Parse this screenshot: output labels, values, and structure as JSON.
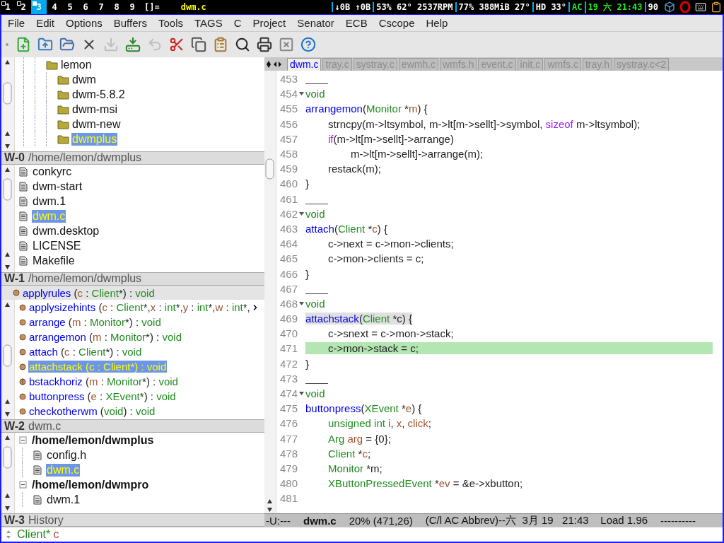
{
  "top_bar": {
    "workspaces": [
      {
        "label": "1",
        "selected": false,
        "occupied": true
      },
      {
        "label": "2",
        "selected": false,
        "occupied": true
      },
      {
        "label": "3",
        "selected": true,
        "occupied": true
      },
      {
        "label": "4",
        "selected": false,
        "occupied": false
      },
      {
        "label": "5",
        "selected": false,
        "occupied": false
      },
      {
        "label": "6",
        "selected": false,
        "occupied": false
      },
      {
        "label": "7",
        "selected": false,
        "occupied": false
      },
      {
        "label": "8",
        "selected": false,
        "occupied": false
      },
      {
        "label": "9",
        "selected": false,
        "occupied": false
      }
    ],
    "layout": "[]=",
    "title": "dwm.c",
    "status": [
      {
        "text": "↓0B ↑0B",
        "color": "#ffffff"
      },
      {
        "text": "53% 62° 2537RPM",
        "color": "#ffffff"
      },
      {
        "text": "77% 388MiB 27°",
        "color": "#ffffff"
      },
      {
        "text": "HD 33°",
        "color": "#ffffff"
      },
      {
        "text": "AC",
        "color": "#22ee22"
      },
      {
        "text": "19 六 21:43",
        "color": "#22ee22"
      },
      {
        "text": "90",
        "color": "#ffffff"
      }
    ],
    "tray": [
      {
        "kind": "dropbox"
      },
      {
        "kind": "ring"
      },
      {
        "kind": "keyboard"
      },
      {
        "kind": "clipboard"
      }
    ]
  },
  "menu": [
    "File",
    "Edit",
    "Options",
    "Buffers",
    "Tools",
    "TAGS",
    "C",
    "Project",
    "Senator",
    "ECB",
    "Cscope",
    "Help"
  ],
  "toolbar": [
    {
      "kind": "new",
      "disabled": false
    },
    {
      "kind": "open",
      "disabled": false
    },
    {
      "kind": "dired",
      "disabled": false
    },
    {
      "kind": "close",
      "disabled": false
    },
    {
      "kind": "save",
      "disabled": true
    },
    {
      "kind": "saveas",
      "disabled": false
    },
    {
      "kind": "undo",
      "disabled": true
    },
    {
      "kind": "cut",
      "disabled": false
    },
    {
      "kind": "copy",
      "disabled": false
    },
    {
      "kind": "paste",
      "disabled": false
    },
    {
      "kind": "search",
      "disabled": false
    },
    {
      "kind": "print",
      "disabled": false
    },
    {
      "kind": "customize",
      "disabled": false
    },
    {
      "kind": "help",
      "disabled": false
    }
  ],
  "directories": {
    "header": {
      "key": "W-0",
      "title": "/home/lemon/dwmplus"
    },
    "tree": [
      {
        "label": "lemon",
        "selected": false,
        "children": [
          {
            "label": "dwm",
            "selected": false
          },
          {
            "label": "dwm-5.8.2",
            "selected": false
          },
          {
            "label": "dwm-msi",
            "selected": false
          },
          {
            "label": "dwm-new",
            "selected": false
          },
          {
            "label": "dwmplus",
            "selected": true
          }
        ]
      }
    ]
  },
  "sources": {
    "header": {
      "key": "W-1",
      "title": "/home/lemon/dwmplus"
    },
    "items": [
      {
        "label": "conkyrc",
        "selected": false
      },
      {
        "label": "dwm-start",
        "selected": false
      },
      {
        "label": "dwm.1",
        "selected": false
      },
      {
        "label": "dwm.c",
        "selected": true
      },
      {
        "label": "dwm.desktop",
        "selected": false
      },
      {
        "label": "LICENSE",
        "selected": false
      },
      {
        "label": "Makefile",
        "selected": false
      }
    ]
  },
  "methods": {
    "header": {
      "key": "W-2",
      "title": "dwm.c"
    },
    "items": [
      {
        "kind": "sticky",
        "selected": false,
        "tokens": [
          {
            "text": "applyrules",
            "kind": "fn"
          },
          {
            "text": " (",
            "kind": "p"
          },
          {
            "text": "c",
            "kind": "var"
          },
          {
            "text": " : ",
            "kind": "p"
          },
          {
            "text": "Client",
            "kind": "type"
          },
          {
            "text": "*) : ",
            "kind": "p"
          },
          {
            "text": "void",
            "kind": "type"
          }
        ]
      },
      {
        "kind": "public",
        "selected": false,
        "truncated": true,
        "tokens": [
          {
            "text": "applysizehints",
            "kind": "fn"
          },
          {
            "text": " (",
            "kind": "p"
          },
          {
            "text": "c",
            "kind": "var"
          },
          {
            "text": " : ",
            "kind": "p"
          },
          {
            "text": "Client",
            "kind": "type"
          },
          {
            "text": "*,",
            "kind": "p"
          },
          {
            "text": "x",
            "kind": "var"
          },
          {
            "text": " : ",
            "kind": "p"
          },
          {
            "text": "int",
            "kind": "type"
          },
          {
            "text": "*,",
            "kind": "p"
          },
          {
            "text": "y",
            "kind": "var"
          },
          {
            "text": " : ",
            "kind": "p"
          },
          {
            "text": "int",
            "kind": "type"
          },
          {
            "text": "*,",
            "kind": "p"
          },
          {
            "text": "w",
            "kind": "var"
          },
          {
            "text": " : ",
            "kind": "p"
          },
          {
            "text": "int",
            "kind": "type"
          },
          {
            "text": "*,",
            "kind": "p"
          }
        ]
      },
      {
        "kind": "public",
        "selected": false,
        "tokens": [
          {
            "text": "arrange",
            "kind": "fn"
          },
          {
            "text": " (",
            "kind": "p"
          },
          {
            "text": "m",
            "kind": "var"
          },
          {
            "text": " : ",
            "kind": "p"
          },
          {
            "text": "Monitor",
            "kind": "type"
          },
          {
            "text": "*) : ",
            "kind": "p"
          },
          {
            "text": "void",
            "kind": "type"
          }
        ]
      },
      {
        "kind": "public",
        "selected": false,
        "tokens": [
          {
            "text": "arrangemon",
            "kind": "fn"
          },
          {
            "text": " (",
            "kind": "p"
          },
          {
            "text": "m",
            "kind": "var"
          },
          {
            "text": " : ",
            "kind": "p"
          },
          {
            "text": "Monitor",
            "kind": "type"
          },
          {
            "text": "*) : ",
            "kind": "p"
          },
          {
            "text": "void",
            "kind": "type"
          }
        ]
      },
      {
        "kind": "public",
        "selected": false,
        "tokens": [
          {
            "text": "attach",
            "kind": "fn"
          },
          {
            "text": " (",
            "kind": "p"
          },
          {
            "text": "c",
            "kind": "var"
          },
          {
            "text": " : ",
            "kind": "p"
          },
          {
            "text": "Client",
            "kind": "type"
          },
          {
            "text": "*) : ",
            "kind": "p"
          },
          {
            "text": "void",
            "kind": "type"
          }
        ]
      },
      {
        "kind": "public",
        "selected": true,
        "tokens": [
          {
            "text": "attachstack",
            "kind": "fn"
          },
          {
            "text": " (",
            "kind": "p"
          },
          {
            "text": "c",
            "kind": "var"
          },
          {
            "text": " : ",
            "kind": "p"
          },
          {
            "text": "Client",
            "kind": "type"
          },
          {
            "text": "*) : ",
            "kind": "p"
          },
          {
            "text": "void",
            "kind": "type"
          }
        ]
      },
      {
        "kind": "static",
        "selected": false,
        "tokens": [
          {
            "text": "bstackhoriz",
            "kind": "fn"
          },
          {
            "text": " (",
            "kind": "p"
          },
          {
            "text": "m",
            "kind": "var"
          },
          {
            "text": " : ",
            "kind": "p"
          },
          {
            "text": "Monitor",
            "kind": "type"
          },
          {
            "text": "*) : ",
            "kind": "p"
          },
          {
            "text": "void",
            "kind": "type"
          }
        ]
      },
      {
        "kind": "public",
        "selected": false,
        "tokens": [
          {
            "text": "buttonpress",
            "kind": "fn"
          },
          {
            "text": " (",
            "kind": "p"
          },
          {
            "text": "e",
            "kind": "var"
          },
          {
            "text": " : ",
            "kind": "p"
          },
          {
            "text": "XEvent",
            "kind": "type"
          },
          {
            "text": "*) : ",
            "kind": "p"
          },
          {
            "text": "void",
            "kind": "type"
          }
        ]
      },
      {
        "kind": "public",
        "selected": false,
        "tokens": [
          {
            "text": "checkotherwm",
            "kind": "fn"
          },
          {
            "text": " (",
            "kind": "p"
          },
          {
            "text": "void",
            "kind": "type"
          },
          {
            "text": ") : ",
            "kind": "p"
          },
          {
            "text": "void",
            "kind": "type"
          }
        ]
      }
    ]
  },
  "history": {
    "header": {
      "key": "W-3",
      "title": "History"
    },
    "tree": [
      {
        "label": "/home/lemon/dwmplus",
        "selected": false,
        "expanded": true,
        "children": [
          {
            "label": "config.h",
            "selected": false
          },
          {
            "label": "dwm.c",
            "selected": true
          }
        ]
      },
      {
        "label": "/home/lemon/dwmpro",
        "selected": false,
        "expanded": true,
        "children": [
          {
            "label": "dwm.1",
            "selected": false
          }
        ]
      }
    ]
  },
  "tabs": [
    {
      "label": "dwm.c",
      "selected": true
    },
    {
      "label": "tray.c",
      "selected": false
    },
    {
      "label": "systray.c",
      "selected": false
    },
    {
      "label": "ewmh.c",
      "selected": false
    },
    {
      "label": "wmfs.h",
      "selected": false
    },
    {
      "label": "event.c",
      "selected": false
    },
    {
      "label": "init.c",
      "selected": false
    },
    {
      "label": "wmfs.c",
      "selected": false
    },
    {
      "label": "tray.h",
      "selected": false
    },
    {
      "label": "systray.c<2",
      "selected": false
    }
  ],
  "code": [
    {
      "num": "453",
      "separator": true
    },
    {
      "num": "454",
      "fold": true,
      "tokens": [
        {
          "text": "void",
          "kind": "type"
        }
      ]
    },
    {
      "num": "455",
      "tokens": [
        {
          "text": "arrangemon",
          "kind": "fn"
        },
        {
          "text": "(",
          "kind": "p"
        },
        {
          "text": "Monitor",
          "kind": "type"
        },
        {
          "text": " *",
          "kind": "p"
        },
        {
          "text": "m",
          "kind": "var"
        },
        {
          "text": ") {",
          "kind": "p"
        }
      ]
    },
    {
      "num": "456",
      "kind": "body",
      "tokens": [
        {
          "text": "strncpy(m->ltsymbol, m->lt[m->sellt]->symbol, ",
          "kind": "p"
        },
        {
          "text": "sizeof",
          "kind": "kw"
        },
        {
          "text": " m->ltsymbol);",
          "kind": "p"
        }
      ]
    },
    {
      "num": "457",
      "kind": "body",
      "tokens": [
        {
          "text": "if",
          "kind": "kw"
        },
        {
          "text": "(m->lt[m->sellt]->arrange)",
          "kind": "p"
        }
      ]
    },
    {
      "num": "458",
      "kind": "nested",
      "tokens": [
        {
          "text": "m->lt[m->sellt]->arrange(m);",
          "kind": "p"
        }
      ]
    },
    {
      "num": "459",
      "kind": "body",
      "tokens": [
        {
          "text": "restack(m);",
          "kind": "p"
        }
      ]
    },
    {
      "num": "460",
      "tokens": [
        {
          "text": "}",
          "kind": "p"
        }
      ]
    },
    {
      "num": "461",
      "separator": true
    },
    {
      "num": "462",
      "fold": true,
      "tokens": [
        {
          "text": "void",
          "kind": "type"
        }
      ]
    },
    {
      "num": "463",
      "tokens": [
        {
          "text": "attach",
          "kind": "fn"
        },
        {
          "text": "(",
          "kind": "p"
        },
        {
          "text": "Client",
          "kind": "type"
        },
        {
          "text": " *",
          "kind": "p"
        },
        {
          "text": "c",
          "kind": "var"
        },
        {
          "text": ") {",
          "kind": "p"
        }
      ]
    },
    {
      "num": "464",
      "kind": "body",
      "tokens": [
        {
          "text": "c->next = c->mon->clients;",
          "kind": "p"
        }
      ]
    },
    {
      "num": "465",
      "kind": "body",
      "tokens": [
        {
          "text": "c->mon->clients = c;",
          "kind": "p"
        }
      ]
    },
    {
      "num": "466",
      "tokens": [
        {
          "text": "}",
          "kind": "p"
        }
      ]
    },
    {
      "num": "467",
      "separator": true
    },
    {
      "num": "468",
      "fold": true,
      "tokens": [
        {
          "text": "void",
          "kind": "type"
        }
      ]
    },
    {
      "num": "469",
      "current_tag": true,
      "tokens": [
        {
          "text": "attachstack",
          "kind": "fn"
        },
        {
          "text": "(",
          "kind": "p"
        },
        {
          "text": "Client",
          "kind": "type"
        },
        {
          "text": " *c) {",
          "kind": "p"
        }
      ]
    },
    {
      "num": "470",
      "kind": "body",
      "tokens": [
        {
          "text": "c->snext = c->mon->stack;",
          "kind": "p"
        }
      ]
    },
    {
      "num": "471",
      "kind": "body",
      "current_line": true,
      "tokens": [
        {
          "text": "c->mon->stack = c;",
          "kind": "p"
        }
      ]
    },
    {
      "num": "472",
      "tokens": [
        {
          "text": "}",
          "kind": "p"
        }
      ]
    },
    {
      "num": "473",
      "separator": true
    },
    {
      "num": "474",
      "fold": true,
      "tokens": [
        {
          "text": "void",
          "kind": "type"
        }
      ]
    },
    {
      "num": "475",
      "tokens": [
        {
          "text": "buttonpress",
          "kind": "fn"
        },
        {
          "text": "(",
          "kind": "p"
        },
        {
          "text": "XEvent",
          "kind": "type"
        },
        {
          "text": " *",
          "kind": "p"
        },
        {
          "text": "e",
          "kind": "var"
        },
        {
          "text": ") {",
          "kind": "p"
        }
      ]
    },
    {
      "num": "476",
      "kind": "body",
      "tokens": [
        {
          "text": "unsigned int",
          "kind": "type"
        },
        {
          "text": " i",
          "kind": "var"
        },
        {
          "text": ", ",
          "kind": "p"
        },
        {
          "text": "x",
          "kind": "var"
        },
        {
          "text": ", ",
          "kind": "p"
        },
        {
          "text": "click",
          "kind": "var"
        },
        {
          "text": ";",
          "kind": "p"
        }
      ]
    },
    {
      "num": "477",
      "kind": "body",
      "tokens": [
        {
          "text": "Arg",
          "kind": "type"
        },
        {
          "text": " arg",
          "kind": "var"
        },
        {
          "text": " = {0};",
          "kind": "p"
        }
      ]
    },
    {
      "num": "478",
      "kind": "body",
      "tokens": [
        {
          "text": "Client",
          "kind": "type"
        },
        {
          "text": " *",
          "kind": "p"
        },
        {
          "text": "c",
          "kind": "var"
        },
        {
          "text": ";",
          "kind": "p"
        }
      ]
    },
    {
      "num": "479",
      "kind": "body",
      "tokens": [
        {
          "text": "Monitor",
          "kind": "type"
        },
        {
          "text": " *m;",
          "kind": "p"
        }
      ]
    },
    {
      "num": "480",
      "kind": "body",
      "tokens": [
        {
          "text": "XButtonPressedEvent",
          "kind": "type"
        },
        {
          "text": " *",
          "kind": "p"
        },
        {
          "text": "ev",
          "kind": "var"
        },
        {
          "text": " = &e->xbutton;",
          "kind": "p"
        }
      ]
    },
    {
      "num": "481"
    }
  ],
  "mode_line": [
    {
      "text": "-U:---",
      "bold": false
    },
    {
      "text": "dwm.c",
      "bold": true
    },
    {
      "text": "20% (471,26)",
      "bold": false
    },
    {
      "text": "(C/l AC Abbrev)--六  3月 19   21:43    Load 1.96",
      "bold": false
    },
    {
      "text": "----------",
      "bold": false
    }
  ],
  "minibuffer": {
    "tokens": [
      {
        "text": "Client*",
        "kind": "type"
      },
      {
        "text": " c",
        "kind": "var"
      }
    ]
  }
}
